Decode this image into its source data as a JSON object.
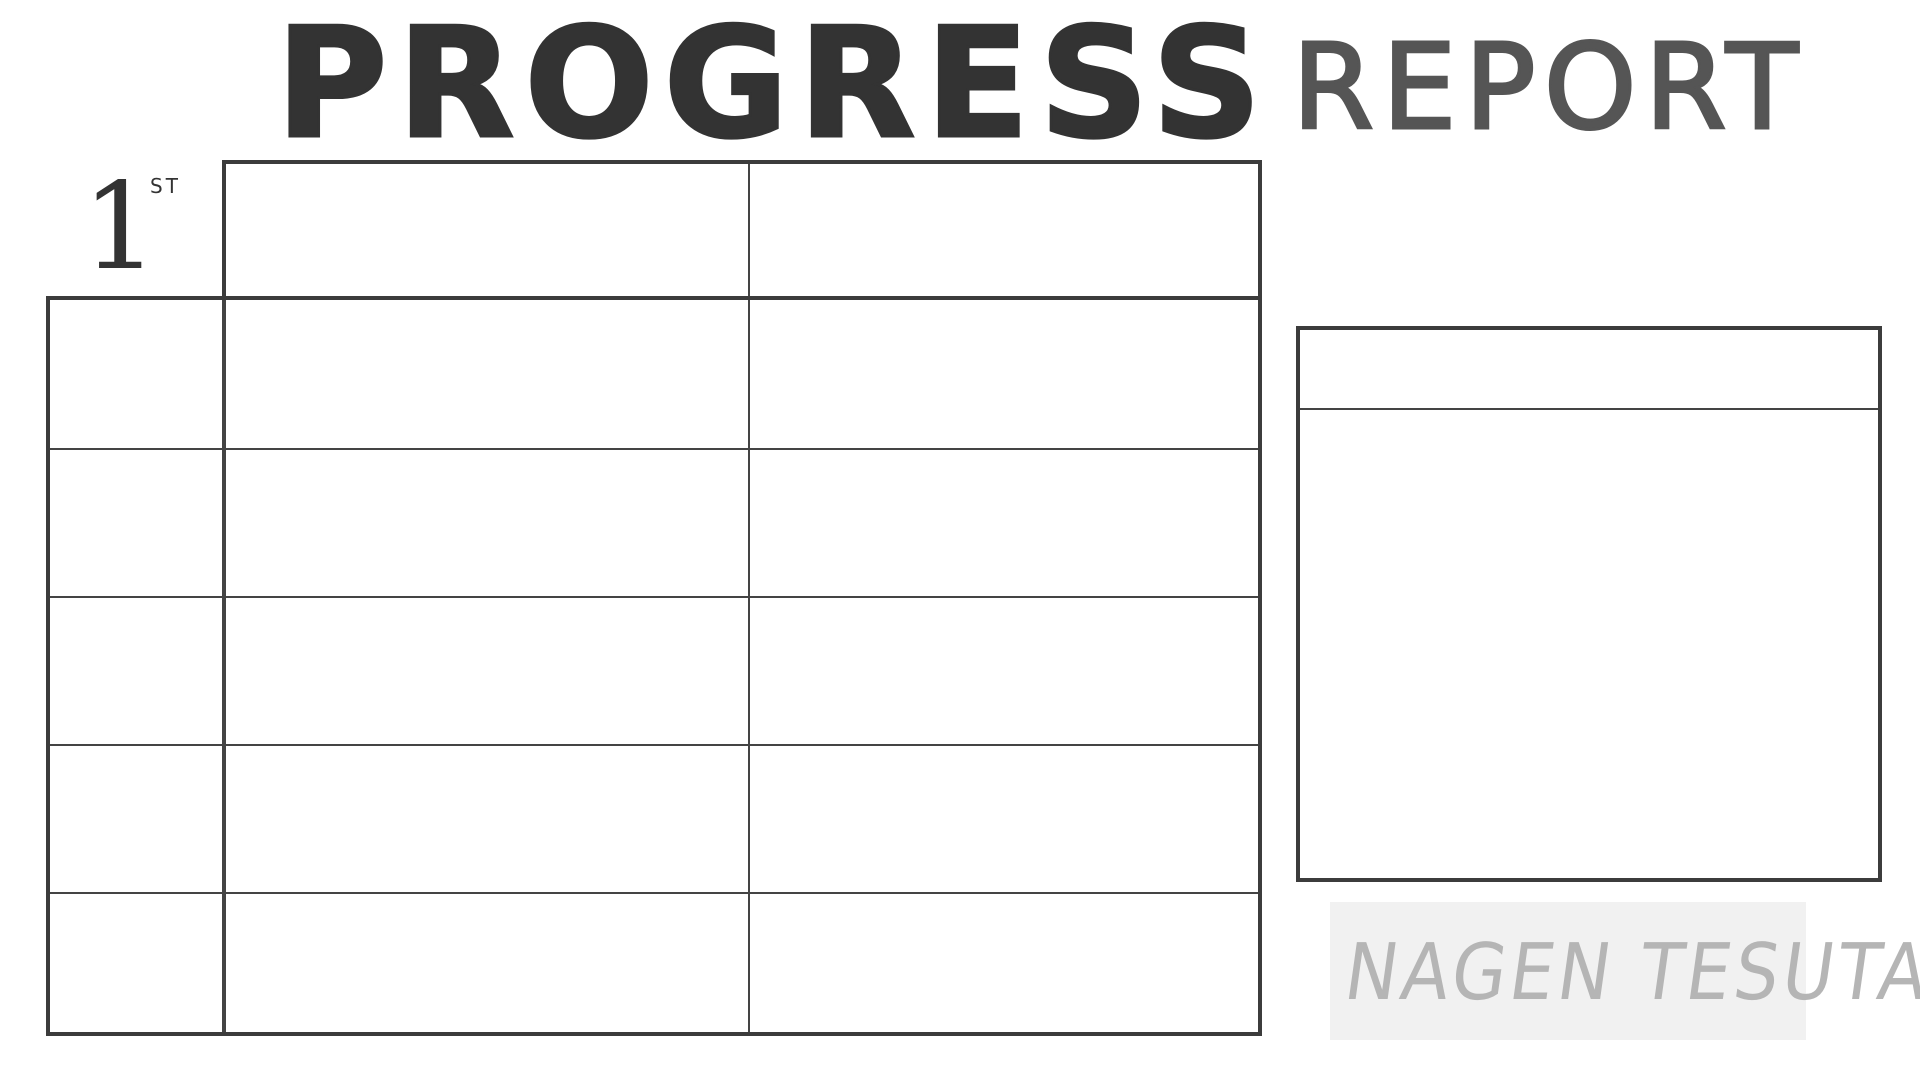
{
  "header": {
    "title_word_1": "PROGRESS",
    "title_word_2": "REPORT"
  },
  "term": {
    "number": "1",
    "suffix": "ST"
  },
  "signature": {
    "name": "NAGEN TESUTA"
  },
  "grid": {
    "main_rows": 5,
    "main_columns": 3,
    "header_columns": 2,
    "line_color": "#3c3c3c"
  },
  "colors": {
    "paper": "#ffffff",
    "ink": "#333333",
    "signature_ink": "#b5b5b5"
  }
}
